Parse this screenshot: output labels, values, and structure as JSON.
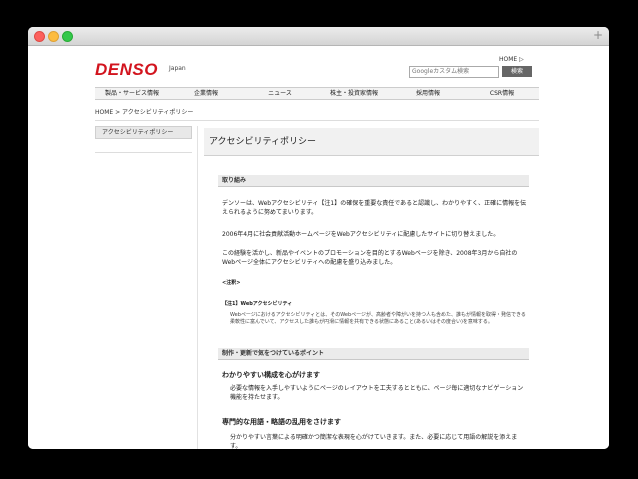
{
  "header": {
    "logo": "DENSO",
    "region": "Japan",
    "home_link": "HOME ▷",
    "search_placeholder": "Googleカスタム検索",
    "search_button": "検索"
  },
  "gnav": [
    {
      "label": "製品・サービス情報"
    },
    {
      "label": "企業情報"
    },
    {
      "label": "ニュース"
    },
    {
      "label": "株主・投資家情報"
    },
    {
      "label": "採用情報"
    },
    {
      "label": "CSR情報"
    }
  ],
  "breadcrumb": "HOME > アクセシビリティポリシー",
  "sidebar": {
    "active_item": "アクセシビリティポリシー"
  },
  "page_title": "アクセシビリティポリシー",
  "section1": {
    "heading": "取り組み",
    "p1": "デンソーは、Webアクセシビリティ【注1】の確保を重要な責任であると認識し、わかりやすく、正確に情報を伝えられるように努めてまいります。",
    "p2": "2006年4月に社会貢献活動ホームページをWebアクセシビリティに配慮したサイトに切り替えました。",
    "p3": "この経験を活かし、新品やイベントのプロモーションを目的とするWebページを除き、2008年3月から自社のWebページ全体にアクセシビリティへの配慮を盛り込みました。",
    "notes_label": "<注釈>",
    "note_title": "【注1】Webアクセシビリティ",
    "note_body": "Webページにおけるアクセシビリティとは、そのWebページが、高齢者や障がいを持つ人も含めた、誰もが情報を取得・発信できる柔軟性に富んでいて、アクセスした誰もが円滑に情報を共有できる状態にあること(あるいはその度合い)を意味する。"
  },
  "section2": {
    "heading": "制作・更新で気をつけているポイント",
    "sub1": "わかりやすい構成を心がけます",
    "sub1_body": "必要な情報を入手しやすいようにページのレイアウトを工夫するとともに、ページ毎に適切なナビゲーション機能を持たせます。",
    "sub2": "専門的な用語・略語の乱用をさけます",
    "sub2_body": "分かりやすい言葉による明確かつ簡潔な表現を心がけていきます。また、必要に応じて用語の解説を添えます。"
  }
}
